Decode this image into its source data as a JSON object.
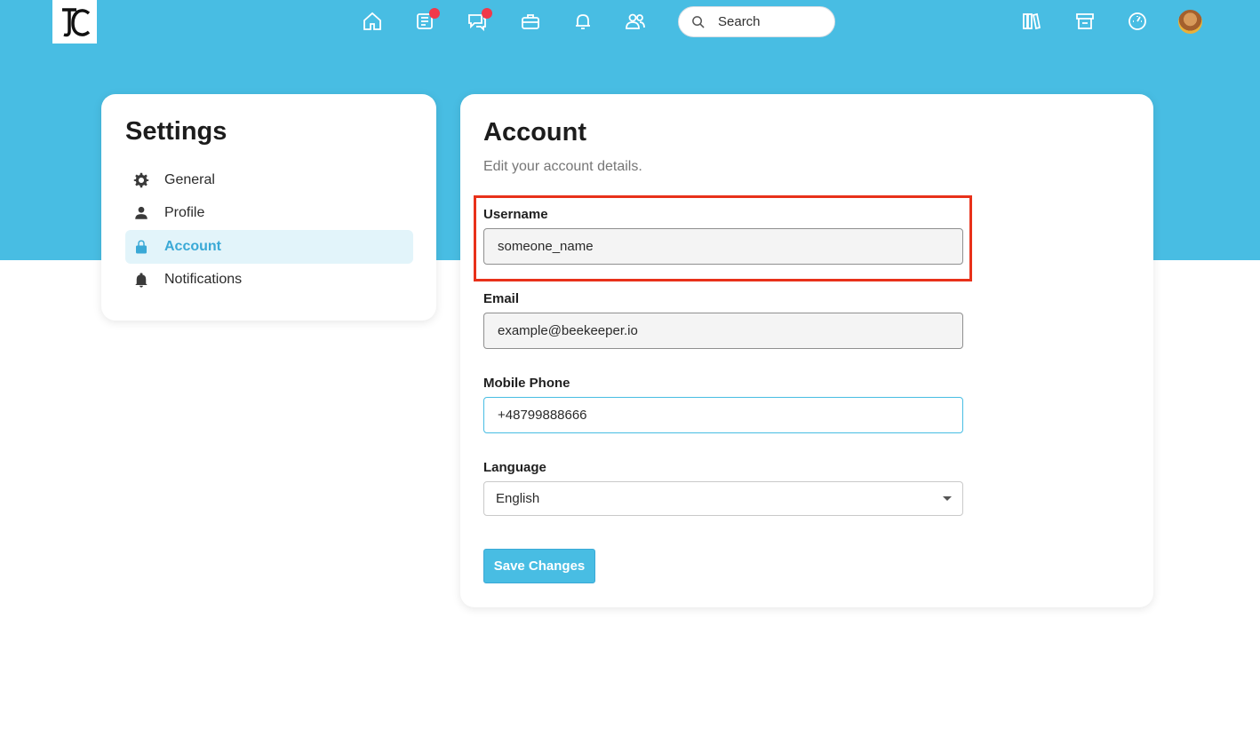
{
  "nav": {
    "search_placeholder": "Search",
    "icons": [
      "home-icon",
      "news-icon",
      "chat-icon",
      "toolbox-icon",
      "bell-icon",
      "people-icon",
      "library-icon",
      "store-icon",
      "dashboard-icon"
    ],
    "badge_color": "#f0394a"
  },
  "settings": {
    "title": "Settings",
    "items": [
      {
        "label": "General",
        "icon": "gear-icon",
        "active": false
      },
      {
        "label": "Profile",
        "icon": "person-icon",
        "active": false
      },
      {
        "label": "Account",
        "icon": "lock-icon",
        "active": true
      },
      {
        "label": "Notifications",
        "icon": "bell-icon",
        "active": false
      }
    ]
  },
  "account": {
    "title": "Account",
    "subtitle": "Edit your account details.",
    "fields": {
      "username": {
        "label": "Username",
        "value": "someone_name"
      },
      "email": {
        "label": "Email",
        "value": "example@beekeeper.io"
      },
      "mobile": {
        "label": "Mobile Phone",
        "value": "+48799888666"
      },
      "language": {
        "label": "Language",
        "value": "English"
      }
    },
    "save_label": "Save Changes"
  },
  "colors": {
    "brand": "#48bde3",
    "active_text": "#3aa9d6",
    "active_bg": "#e2f4fa",
    "highlight": "#e8311a"
  }
}
